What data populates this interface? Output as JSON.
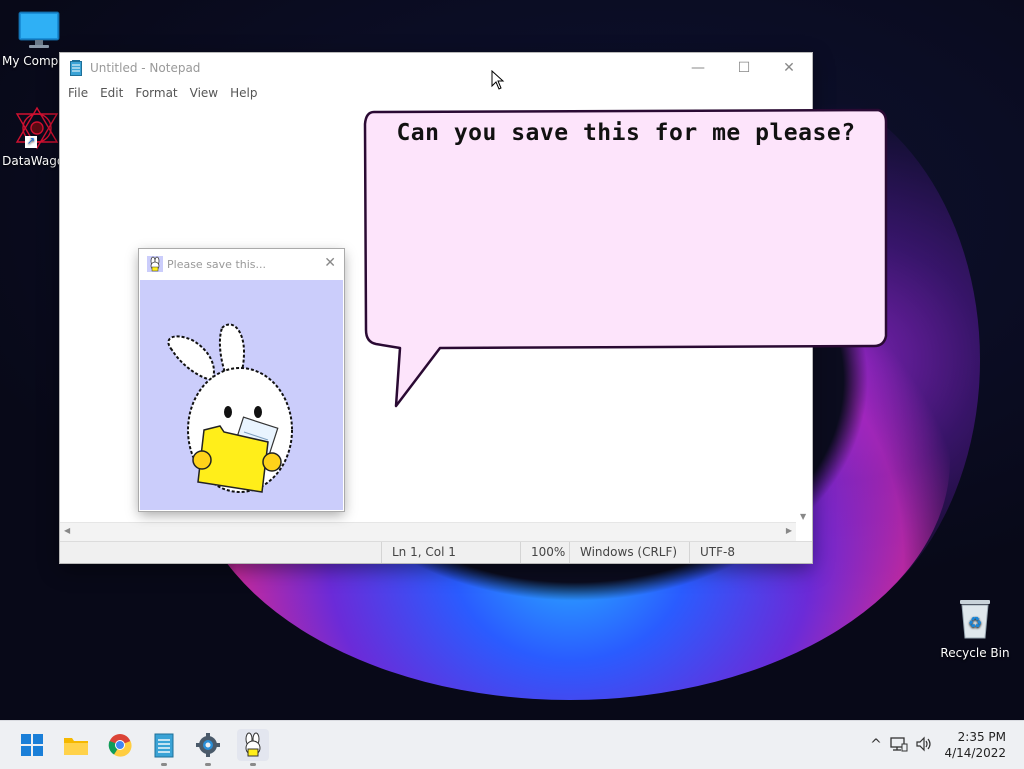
{
  "desktop": {
    "icons": [
      {
        "label": "My Compu",
        "icon": "computer-icon"
      },
      {
        "label": "DataWagon",
        "icon": "datawagon-icon"
      },
      {
        "label": "Recycle Bin",
        "icon": "recycle-bin-icon"
      }
    ]
  },
  "notepad": {
    "title": "Untitled - Notepad",
    "menu": [
      "File",
      "Edit",
      "Format",
      "View",
      "Help"
    ],
    "content": "",
    "status": {
      "position": "Ln 1, Col 1",
      "zoom": "100%",
      "line_endings": "Windows (CRLF)",
      "encoding": "UTF-8"
    }
  },
  "popup": {
    "title": "Please save this...",
    "image_desc_icon": "bunny-holding-folder"
  },
  "bubble": {
    "text": "Can you save this for me please?"
  },
  "taskbar": {
    "apps": [
      {
        "icon": "start-icon",
        "running": false
      },
      {
        "icon": "file-explorer-icon",
        "running": false
      },
      {
        "icon": "chrome-icon",
        "running": false
      },
      {
        "icon": "notepad-icon",
        "running": true
      },
      {
        "icon": "settings-icon",
        "running": true
      },
      {
        "icon": "bunny-app-icon",
        "running": true
      }
    ],
    "clock": {
      "time": "2:35 PM",
      "date": "4/14/2022"
    }
  },
  "colors": {
    "bubble_fill": "#fde4fb",
    "bubble_stroke": "#3a0a44",
    "popup_bg": "#cbcdfb",
    "folder_yellow": "#ffee1a",
    "taskbar_bg": "#eef0f3"
  }
}
